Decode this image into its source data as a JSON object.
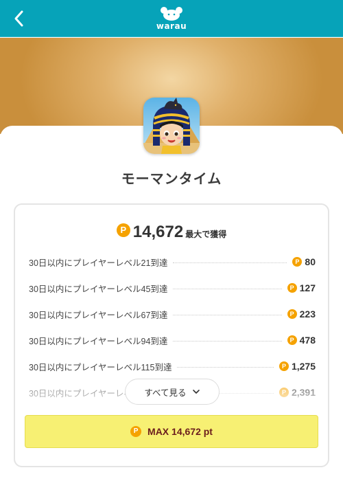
{
  "header": {
    "logo_text": "warau",
    "back_icon": "chevron-left-icon",
    "background": "#06a3b9"
  },
  "app": {
    "title": "モーマンタイム",
    "icon": "app-icon-cleopatra-character"
  },
  "points": {
    "coin_symbol": "P",
    "coin_color": "#f5a200",
    "total": "14,672",
    "total_suffix": "最大で獲得"
  },
  "rewards": [
    {
      "label": "30日以内にプレイヤーレベル21到達",
      "points": "80"
    },
    {
      "label": "30日以内にプレイヤーレベル45到達",
      "points": "127"
    },
    {
      "label": "30日以内にプレイヤーレベル67到達",
      "points": "223"
    },
    {
      "label": "30日以内にプレイヤーレベル94到達",
      "points": "478"
    },
    {
      "label": "30日以内にプレイヤーレベル115到達",
      "points": "1,275"
    },
    {
      "label": "30日以内にプレイヤーレベル",
      "points": "2,391"
    }
  ],
  "see_all": {
    "label": "すべて見る",
    "icon": "chevron-down-icon"
  },
  "max_button": {
    "label": "MAX 14,672 pt",
    "background": "#f7f073"
  }
}
